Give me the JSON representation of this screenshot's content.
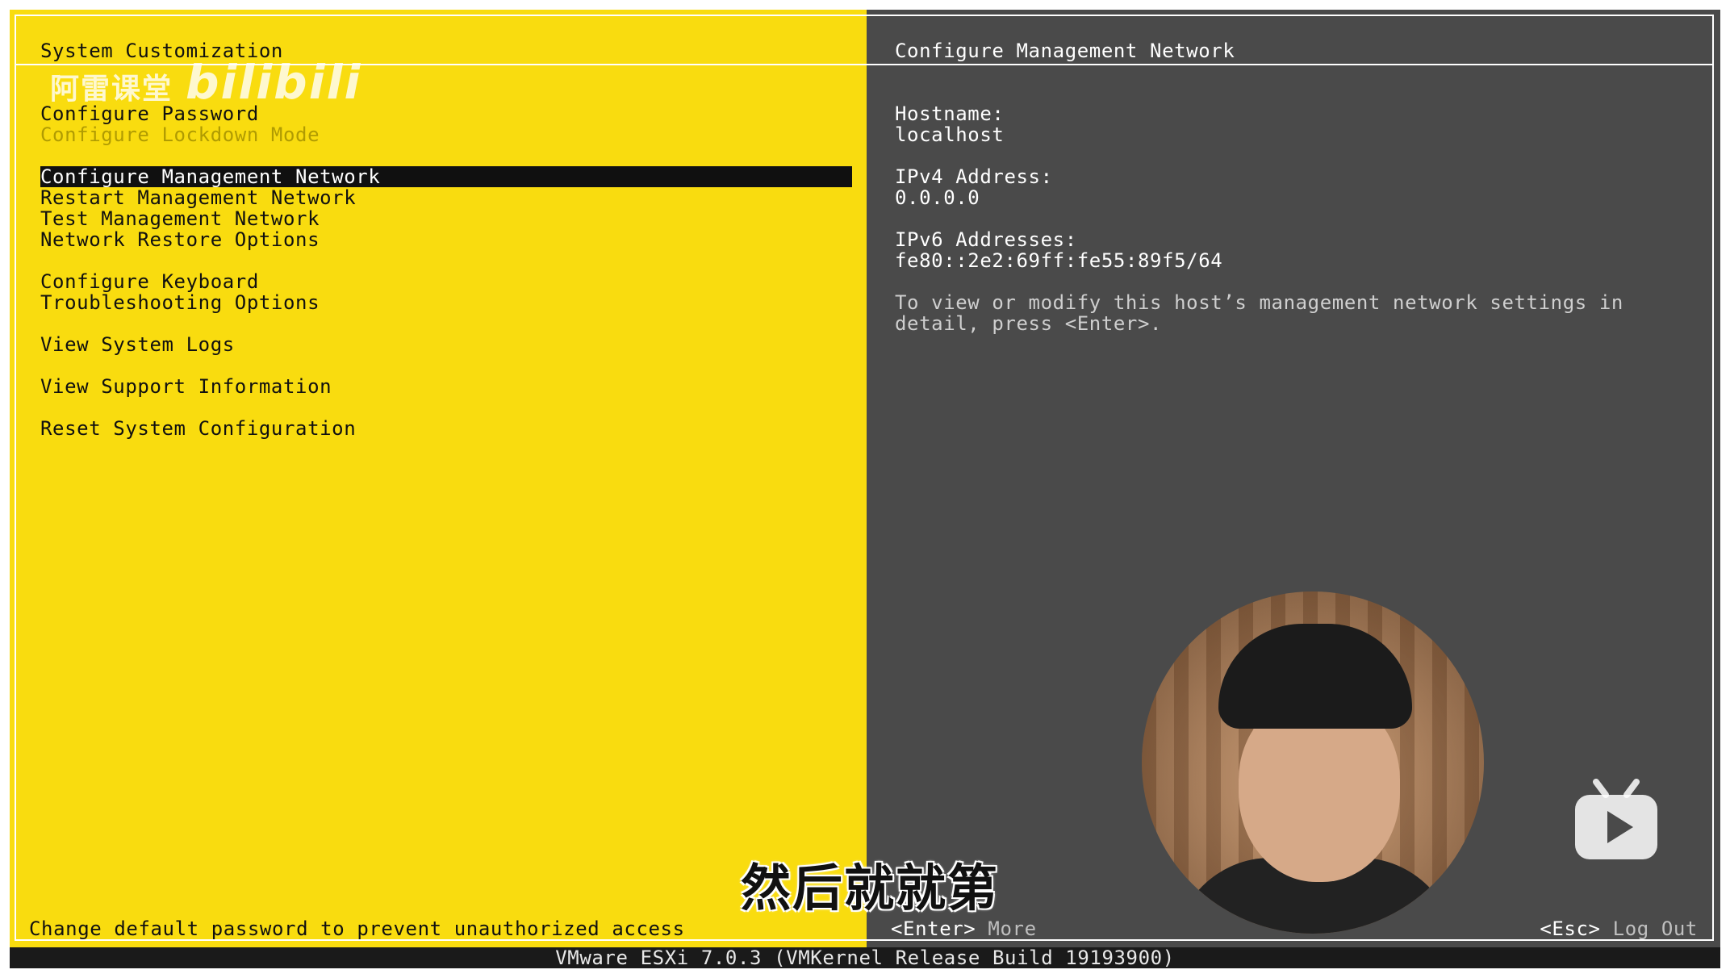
{
  "left_pane": {
    "title": "System Customization",
    "menu": [
      {
        "label": "Configure Password",
        "state": "normal"
      },
      {
        "label": "Configure Lockdown Mode",
        "state": "disabled"
      },
      {
        "label": "Configure Management Network",
        "state": "selected"
      },
      {
        "label": "Restart Management Network",
        "state": "normal"
      },
      {
        "label": "Test Management Network",
        "state": "normal"
      },
      {
        "label": "Network Restore Options",
        "state": "normal"
      },
      {
        "label": "Configure Keyboard",
        "state": "normal"
      },
      {
        "label": "Troubleshooting Options",
        "state": "normal"
      },
      {
        "label": "View System Logs",
        "state": "normal"
      },
      {
        "label": "View Support Information",
        "state": "normal"
      },
      {
        "label": "Reset System Configuration",
        "state": "normal"
      }
    ],
    "footer_text": "Change default password to prevent unauthorized access"
  },
  "right_pane": {
    "title": "Configure Management Network",
    "hostname_label": "Hostname:",
    "hostname_value": "localhost",
    "ipv4_label": "IPv4 Address:",
    "ipv4_value": "0.0.0.0",
    "ipv6_label": "IPv6 Addresses:",
    "ipv6_value": "fe80::2e2:69ff:fe55:89f5/64",
    "hint": "To view or modify this host’s management network settings in detail, press <Enter>.",
    "enter_key": "<Enter>",
    "enter_label": "More",
    "esc_key": "<Esc>",
    "esc_label": "Log Out"
  },
  "status_bar": "VMware ESXi 7.0.3 (VMKernel Release Build 19193900)",
  "overlay": {
    "watermark_cn": "阿雷课堂",
    "watermark_brand": "bilibili",
    "subtitle": "然后就就第"
  },
  "colors": {
    "left_bg": "#f9dc0f",
    "right_bg": "#4a4a4a",
    "selected_bg": "#101010"
  }
}
